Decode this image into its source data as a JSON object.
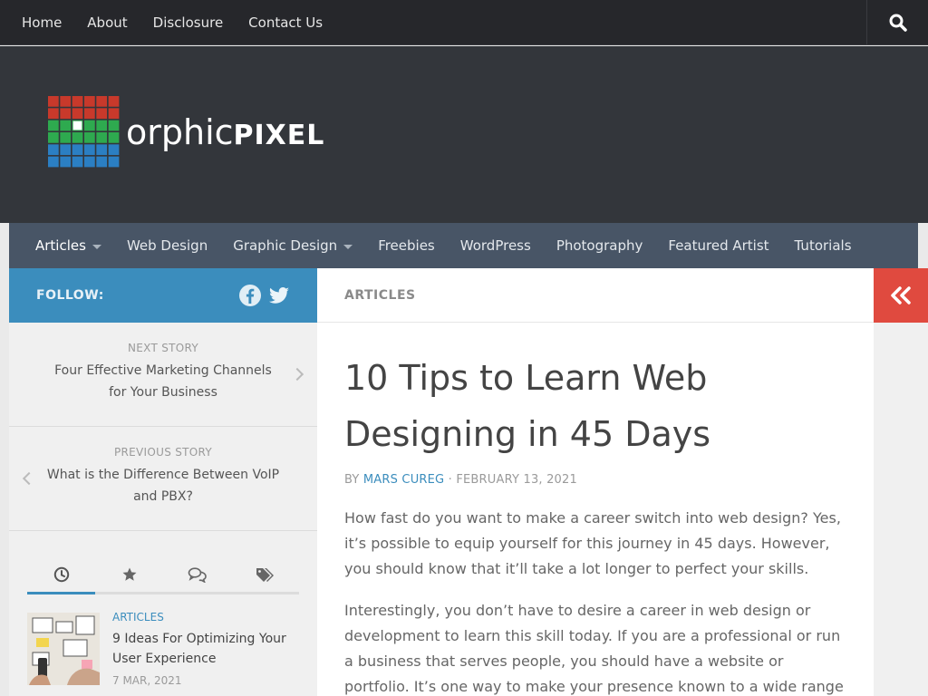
{
  "topnav": {
    "items": [
      "Home",
      "About",
      "Disclosure",
      "Contact Us"
    ]
  },
  "logo": {
    "text_a": "orphic",
    "text_b": "PIXEL",
    "colors": [
      "#c8392b",
      "#2eaa4f",
      "#2b7fc3"
    ]
  },
  "mainnav": {
    "items": [
      {
        "label": "Articles",
        "dropdown": true,
        "active": true
      },
      {
        "label": "Web Design",
        "dropdown": false
      },
      {
        "label": "Graphic Design",
        "dropdown": true
      },
      {
        "label": "Freebies",
        "dropdown": false
      },
      {
        "label": "WordPress",
        "dropdown": false
      },
      {
        "label": "Photography",
        "dropdown": false
      },
      {
        "label": "Featured Artist",
        "dropdown": false
      },
      {
        "label": "Tutorials",
        "dropdown": false
      }
    ]
  },
  "follow": {
    "label": "FOLLOW:",
    "icons": [
      "facebook-icon",
      "twitter-icon"
    ]
  },
  "sidebar": {
    "next": {
      "kicker": "NEXT STORY",
      "title": "Four Effective Marketing Channels for Your Business"
    },
    "previous": {
      "kicker": "PREVIOUS STORY",
      "title": "What is the Difference Between VoIP and PBX?"
    },
    "tabs": [
      "clock-icon",
      "star-icon",
      "comments-icon",
      "tags-icon"
    ],
    "post": {
      "category": "ARTICLES",
      "title": "9 Ideas For Optimizing Your User Experience",
      "date": "7 MAR, 2021"
    }
  },
  "content": {
    "breadcrumb": "ARTICLES",
    "title": "10 Tips to Learn Web Designing in 45 Days",
    "byline_prefix": "BY ",
    "author": "MARS CUREG",
    "byline_sep": " · ",
    "date": "FEBRUARY 13, 2021",
    "paragraphs": [
      "How fast do you want to make a career switch into web design? Yes, it’s possible to equip yourself for this journey in 45 days. However, you should know that it’ll take a lot longer to perfect your skills.",
      "Interestingly, you don’t have to desire a career in web design or development to learn this skill today. If you are a professional or run a business that serves people, you should have a website or portfolio. It’s one way to make your presence known to a wide range of prospects."
    ]
  },
  "colors": {
    "accent": "#3b8dbd",
    "collapse": "#e04a3f",
    "nav_bg": "#485566",
    "header_bg": "#33363b",
    "topbar_bg": "#26272b"
  }
}
